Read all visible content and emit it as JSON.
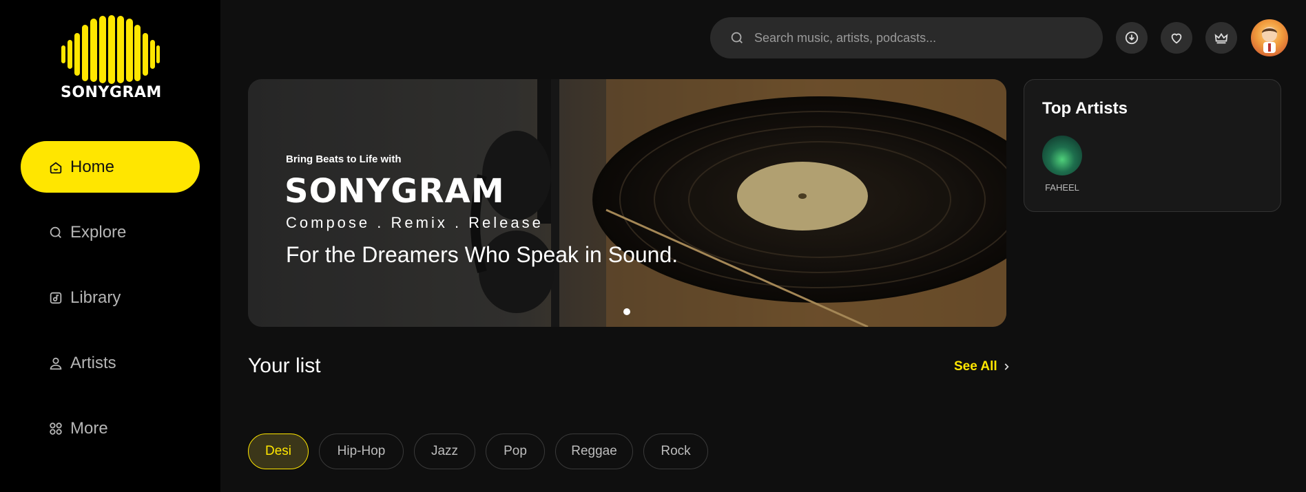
{
  "brand": {
    "logo_text": "SONYGRAM",
    "accent": "#ffe600"
  },
  "sidebar": {
    "items": [
      {
        "label": "Home",
        "icon": "home-icon",
        "active": true
      },
      {
        "label": "Explore",
        "icon": "search-icon",
        "active": false
      },
      {
        "label": "Library",
        "icon": "library-icon",
        "active": false
      },
      {
        "label": "Artists",
        "icon": "user-icon",
        "active": false
      },
      {
        "label": "More",
        "icon": "grid-icon",
        "active": false
      }
    ]
  },
  "topbar": {
    "search_placeholder": "Search music, artists, podcasts...",
    "icons": [
      "download-icon",
      "heart-icon",
      "crown-icon"
    ]
  },
  "hero": {
    "small_text": "Bring Beats to Life with",
    "brand": "SONYGRAM",
    "tagline": "Compose . Remix . Release",
    "headline": "For the Dreamers Who Speak in Sound."
  },
  "top_artists": {
    "title": "Top Artists",
    "artists": [
      {
        "name": "FAHEEL"
      }
    ]
  },
  "your_list": {
    "title": "Your list",
    "see_all": "See All",
    "genres": [
      "Desi",
      "Hip-Hop",
      "Jazz",
      "Pop",
      "Reggae",
      "Rock"
    ],
    "active_genre": "Desi"
  }
}
